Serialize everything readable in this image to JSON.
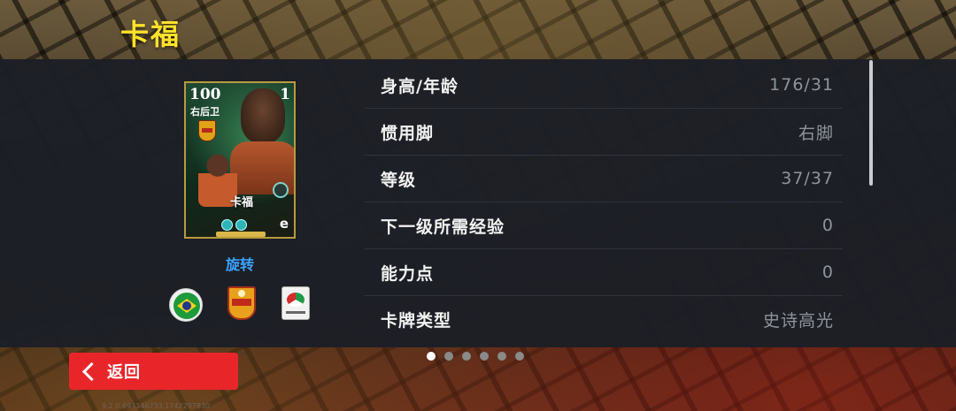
{
  "header": {
    "title": "卡福"
  },
  "card": {
    "rating": "100",
    "level": "1",
    "position": "右后卫",
    "name": "卡福",
    "e_mark": "e"
  },
  "rotate_label": "旋转",
  "emblems": [
    "brazil-flag",
    "club-crest",
    "league-badge"
  ],
  "stats": [
    {
      "label": "身高/年龄",
      "value": "176/31"
    },
    {
      "label": "惯用脚",
      "value": "右脚"
    },
    {
      "label": "等级",
      "value": "37/37"
    },
    {
      "label": "下一级所需经验",
      "value": "0"
    },
    {
      "label": "能力点",
      "value": "0"
    },
    {
      "label": "卡牌类型",
      "value": "史诗高光"
    }
  ],
  "pager": {
    "count": 6,
    "active": 0
  },
  "back_button": {
    "label": "返回"
  },
  "version": "9.2.0.693346733.1742297830",
  "colors": {
    "title": "#ffe22a",
    "accent": "#3aa3ff",
    "back": "#e8262a"
  }
}
